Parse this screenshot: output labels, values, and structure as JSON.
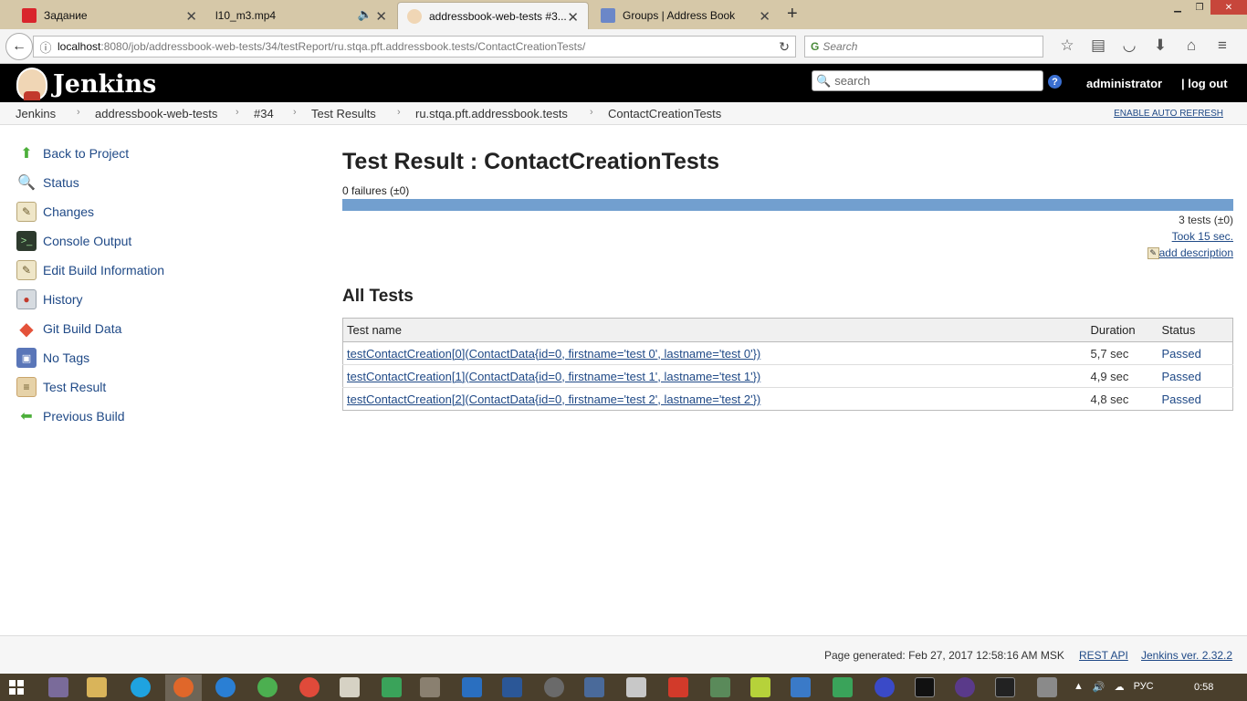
{
  "browser": {
    "tabs": [
      {
        "label": "Задание",
        "icon_color": "#d9252c"
      },
      {
        "label": "l10_m3.mp4",
        "icon_color": "#cccccc"
      },
      {
        "label": "addressbook-web-tests #3...",
        "icon_color": "#f0d6b5"
      },
      {
        "label": "Groups | Address Book",
        "icon_color": "#6b87c8"
      }
    ],
    "url_host": "localhost",
    "url_path": ":8080/job/addressbook-web-tests/34/testReport/ru.stqa.pft.addressbook.tests/ContactCreationTests/",
    "search_placeholder": "Search"
  },
  "jenkins": {
    "logo_text": "Jenkins",
    "search_placeholder": "search",
    "user": "administrator",
    "logout": "| log out"
  },
  "breadcrumbs": [
    "Jenkins",
    "addressbook-web-tests",
    "#34",
    "Test Results",
    "ru.stqa.pft.addressbook.tests",
    "ContactCreationTests"
  ],
  "auto_refresh": "ENABLE AUTO REFRESH",
  "sidebar": {
    "items": [
      {
        "label": "Back to Project",
        "icon": "arrow-up-icon",
        "color": "#4caf3a"
      },
      {
        "label": "Status",
        "icon": "magnifier-icon",
        "color": "#7a8fa6"
      },
      {
        "label": "Changes",
        "icon": "notepad-icon",
        "color": "#d8c79a"
      },
      {
        "label": "Console Output",
        "icon": "terminal-icon",
        "color": "#2d3a2d"
      },
      {
        "label": "Edit Build Information",
        "icon": "notepad-edit-icon",
        "color": "#d8c79a"
      },
      {
        "label": "History",
        "icon": "history-icon",
        "color": "#9aa3ad"
      },
      {
        "label": "Git Build Data",
        "icon": "git-icon",
        "color": "#e4523a"
      },
      {
        "label": "No Tags",
        "icon": "save-icon",
        "color": "#5a76b8"
      },
      {
        "label": "Test Result",
        "icon": "clipboard-icon",
        "color": "#c9a46b"
      },
      {
        "label": "Previous Build",
        "icon": "arrow-left-icon",
        "color": "#4caf3a"
      }
    ]
  },
  "main": {
    "title": "Test Result : ContactCreationTests",
    "failures": "0 failures (±0)",
    "tests_count": "3 tests (±0)",
    "took": "Took 15 sec.",
    "add_description": "add description",
    "all_tests_heading": "All Tests",
    "columns": [
      "Test name",
      "Duration",
      "Status"
    ],
    "rows": [
      {
        "name": "testContactCreation[0](ContactData{id=0, firstname='test 0', lastname='test 0'})",
        "duration": "5,7 sec",
        "status": "Passed"
      },
      {
        "name": "testContactCreation[1](ContactData{id=0, firstname='test 1', lastname='test 1'})",
        "duration": "4,9 sec",
        "status": "Passed"
      },
      {
        "name": "testContactCreation[2](ContactData{id=0, firstname='test 2', lastname='test 2'})",
        "duration": "4,8 sec",
        "status": "Passed"
      }
    ]
  },
  "footer": {
    "generated": "Page generated: Feb 27, 2017 12:58:16 AM MSK",
    "rest_api": "REST API",
    "version": "Jenkins ver. 2.32.2"
  },
  "taskbar": {
    "lang": "РУС",
    "time": "0:58"
  }
}
